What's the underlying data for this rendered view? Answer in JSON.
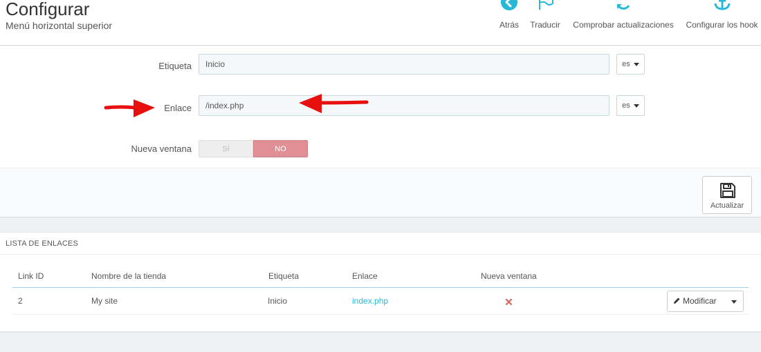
{
  "header": {
    "title": "Configurar",
    "subtitle": "Menú horizontal superior"
  },
  "toolbar": {
    "items": [
      {
        "label": "Atrás",
        "icon": "arrow-left-circle-icon"
      },
      {
        "label": "Traducir",
        "icon": "flag-icon"
      },
      {
        "label": "Comprobar actualizaciones",
        "icon": "refresh-icon"
      },
      {
        "label": "Configurar los hook",
        "icon": "anchor-icon"
      }
    ]
  },
  "form": {
    "label_field": {
      "label": "Etiqueta",
      "value": "Inicio",
      "lang": "es"
    },
    "link_field": {
      "label": "Enlace",
      "value": "/index.php",
      "lang": "es"
    },
    "new_window": {
      "label": "Nueva ventana",
      "yes": "SÍ",
      "no": "NO",
      "selected": "NO"
    },
    "save_label": "Actualizar"
  },
  "list": {
    "heading": "LISTA DE ENLACES",
    "columns": [
      "Link ID",
      "Nombre de la tienda",
      "Etiqueta",
      "Enlace",
      "Nueva ventana"
    ],
    "rows": [
      {
        "link_id": "2",
        "shop": "My site",
        "label": "Inicio",
        "link": "index.php",
        "new_window": false
      }
    ],
    "modify_label": "Modificar"
  },
  "colors": {
    "accent": "#25b9d7",
    "no_active": "#e08f95",
    "annotation_arrow": "#e8100f",
    "delete_x": "#d9655f"
  }
}
